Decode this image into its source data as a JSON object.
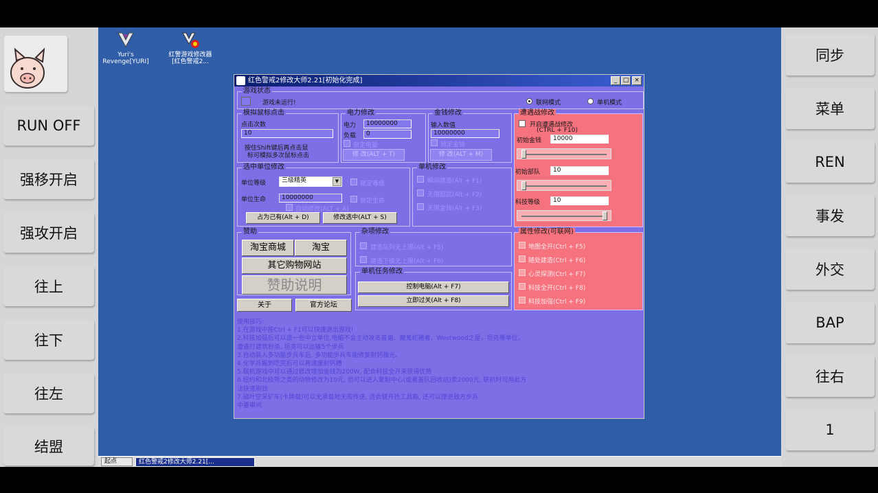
{
  "left_panel": {
    "buttons": [
      "RUN OFF",
      "强移开启",
      "强攻开启",
      "往上",
      "往下",
      "往左",
      "结盟"
    ]
  },
  "right_panel": {
    "buttons": [
      "同步",
      "菜单",
      "REN",
      "事发",
      "外交",
      "BAP",
      "往右",
      "1"
    ]
  },
  "desktop": {
    "icons": [
      {
        "label_line1": "Yuri's",
        "label_line2": "Revenge[YURI]",
        "icon": "yuri-logo-icon"
      },
      {
        "label_line1": "红警游戏修改器",
        "label_line2": "[红色警戒2...",
        "icon": "trainer-logo-icon"
      }
    ]
  },
  "taskbar": {
    "start_label": "起点",
    "task_label": "红色警戒2修改大师2.21[..."
  },
  "window": {
    "title": "红色警戒2修改大师2.21[初始化完成]",
    "controls": {
      "minimize": "_",
      "maximize": "□",
      "close": "×"
    },
    "game_status": {
      "title": "游戏状态",
      "text": "游戏未运行!",
      "mode_online": "联网模式",
      "mode_single": "单机模式"
    },
    "mouse": {
      "title": "模拟鼠标点击",
      "count_label": "点击次数",
      "count_value": "10",
      "hint1": "按住Shift键后再点击鼠",
      "hint2": "标可模拟多次鼠标点击"
    },
    "power": {
      "title": "电力修改",
      "power_label": "电力",
      "power_value": "10000000",
      "load_label": "负载",
      "load_value": "0",
      "lock_label": "锁定电量",
      "button": "修 改(ALT + T)"
    },
    "money": {
      "title": "金钱修改",
      "input_label": "输入数值",
      "input_value": "10000000",
      "lock_label": "锁定金钱",
      "button": "修 改(ALT + M)"
    },
    "encounter": {
      "title": "遭遇战修改",
      "enable_label": "开启遭遇战修改",
      "hotkey": "(CTRL + F10)",
      "money_label": "初始金钱",
      "money_value": "10000",
      "team_label": "初始部队",
      "team_value": "10",
      "tech_label": "科技等级",
      "tech_value": "10"
    },
    "unit": {
      "title": "选中单位修改",
      "level_label": "单位等级",
      "level_value": "三级精英",
      "lock_level": "锁定等级",
      "life_label": "单位生命",
      "life_value": "10000000",
      "lock_life": "锁定生命",
      "auto_modify": "自动修改(ALT + A)",
      "occupy_button": "占为己有(Alt + D)",
      "modify_button": "修改选中(ALT + S)"
    },
    "single": {
      "title": "单机修改",
      "items": [
        "瞬间建造(Alt + F1)",
        "无限超武(Alt + F2)",
        "无限金钱(Alt + F3)"
      ]
    },
    "sponsor": {
      "title": "赞助",
      "taobao_mall": "淘宝商城",
      "taobao": "淘宝",
      "other_shops": "其它购物网站",
      "sponsor_info": "赞助说明",
      "about": "关于",
      "forum": "官方论坛"
    },
    "misc": {
      "title": "杂项修改",
      "items": [
        "建造队列无上限(Alt + F5)",
        "建造下级无上限(Alt + F6)"
      ]
    },
    "mission": {
      "title": "单机任务修改",
      "control_ai": "控制电脑(Alt + F7)",
      "instant_win": "立即过关(Alt + F8)"
    },
    "attributes": {
      "title": "属性修改(可联网)",
      "items": [
        "地图全开(Ctrl + F5)",
        "随处建造(Ctrl + F6)",
        "心灵探测(Ctrl + F7)",
        "科技全开(Ctrl + F8)",
        "科技加强(Ctrl + F9)"
      ]
    },
    "tips": {
      "title": "使用技巧:",
      "lines": [
        "1.在游戏中按Ctrl + F1可以快速退出游戏!",
        "2.科技加强后可以造一些中立单位,电脑不会主动攻击普遍、魔鬼蛇猪者、Westwood之星、坦克等单位。",
        "遭遇打建筑秒杀, 坦克可以运输5个步兵",
        "3.自动装入多功能步兵车后, 多功能步兵车能修复射钙雅光。",
        "4.化学兵搬到吃完后可以再速度射钙槽",
        "5.联机游戏中可以通过修改增加金钱为200W, 配合科技全开来获得优势",
        "6.纽约和北极熊之类的动物修改为10元, 但可以进入复制中心(或者盖队回收站)卖2000元, 联机时可用此方",
        "法快速刷钱",
        "7.磁叶空采矿车(卡牌载)可以无承载地无限传送, 适合联开抢工具箱, 还可以撑进敌方步兵",
        "中要审问"
      ]
    }
  }
}
